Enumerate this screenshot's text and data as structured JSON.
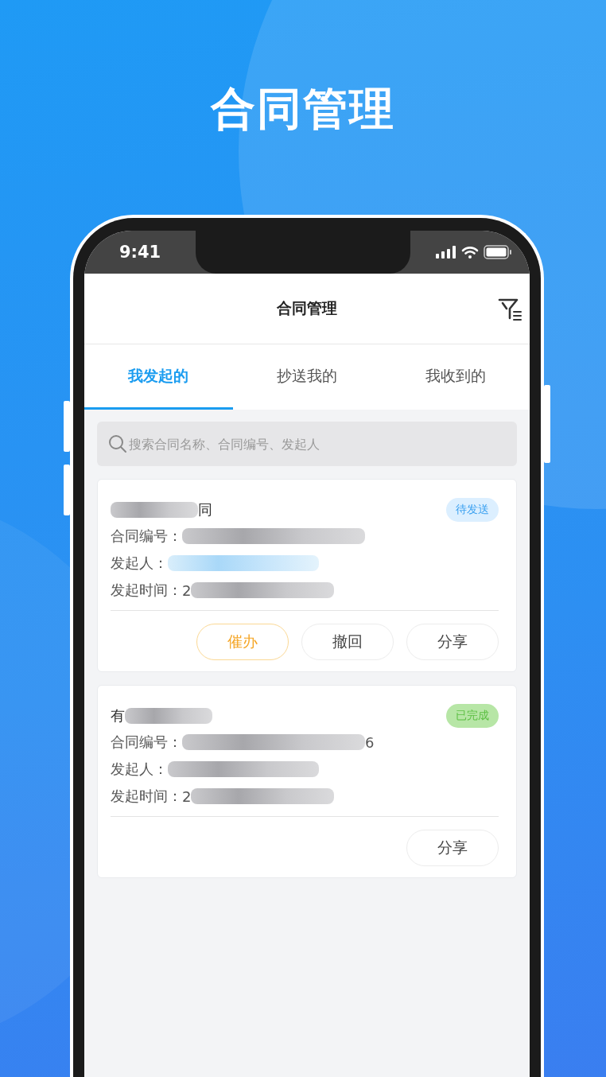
{
  "headline": "合同管理",
  "status_bar": {
    "time": "9:41"
  },
  "nav": {
    "title": "合同管理"
  },
  "tabs": [
    {
      "label": "我发起的",
      "selected": true
    },
    {
      "label": "抄送我的",
      "selected": false
    },
    {
      "label": "我收到的",
      "selected": false
    }
  ],
  "search": {
    "placeholder": "搜索合同名称、合同编号、发起人"
  },
  "contracts": [
    {
      "title_tail": "同",
      "status": {
        "label": "待发送",
        "kind": "pending"
      },
      "fields": [
        {
          "label": "合同编号：",
          "kind": "plain"
        },
        {
          "label": "发起人：",
          "kind": "link"
        },
        {
          "label": "发起时间：",
          "kind": "plain",
          "head": "2"
        }
      ],
      "actions": [
        {
          "label": "催办",
          "kind": "primary"
        },
        {
          "label": "撤回",
          "kind": "normal"
        },
        {
          "label": "分享",
          "kind": "normal"
        }
      ]
    },
    {
      "title_head": "有",
      "status": {
        "label": "已完成",
        "kind": "done"
      },
      "fields": [
        {
          "label": "合同编号：",
          "kind": "plain",
          "tail": "6"
        },
        {
          "label": "发起人：",
          "kind": "plain"
        },
        {
          "label": "发起时间：",
          "kind": "plain",
          "head": "2"
        }
      ],
      "actions": [
        {
          "label": "分享",
          "kind": "normal"
        }
      ]
    }
  ]
}
